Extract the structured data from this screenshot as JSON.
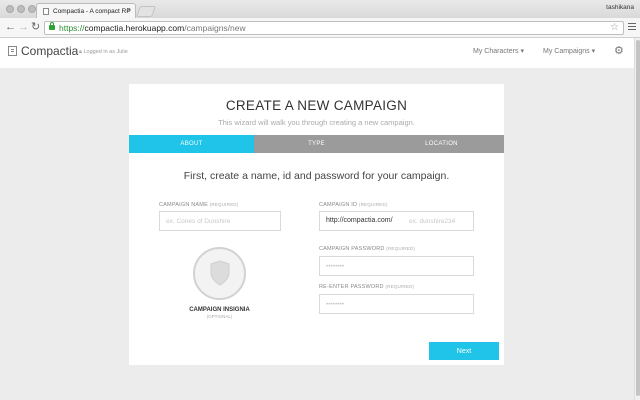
{
  "browser": {
    "tab_title": "Compactia - A compact RP",
    "user": "tashikana",
    "url_protocol": "https://",
    "url_host": "compactia.herokuapp.com",
    "url_path": "/campaigns/new"
  },
  "header": {
    "brand": "Compactia",
    "logged_in": "Logged in as Julie",
    "nav": [
      "My Characters",
      "My Campaigns"
    ],
    "icons": [
      "logo-icon",
      "lock-icon",
      "gear-icon"
    ]
  },
  "wizard": {
    "title": "CREATE A NEW CAMPAIGN",
    "subtitle": "This wizard will walk you through creating a new campaign.",
    "steps": [
      "ABOUT",
      "TYPE",
      "LOCATION"
    ],
    "active_step": "ABOUT",
    "lead": "First, create a name, id and password for your campaign."
  },
  "form": {
    "name_label": "CAMPAIGN NAME",
    "name_required": "(REQUIRED)",
    "name_placeholder": "ex. Cones of Dunshire",
    "id_label": "CAMPAIGN ID",
    "id_required": "(REQUIRED)",
    "id_prefix": "http://compactia.com/",
    "id_placeholder": "ex. dunshire234",
    "password_label": "CAMPAIGN PASSWORD",
    "password_required": "(REQUIRED)",
    "password_placeholder": "••••••••",
    "reenter_label": "RE-ENTER PASSWORD",
    "reenter_required": "(REQUIRED)",
    "reenter_placeholder": "••••••••",
    "insignia_label": "CAMPAIGN INSIGNIA",
    "insignia_optional": "(OPTIONAL)",
    "next_label": "Next"
  },
  "colors": {
    "accent": "#1fc4e8",
    "step_inactive": "#9b9b9b",
    "url_green": "#2a8f2f"
  }
}
